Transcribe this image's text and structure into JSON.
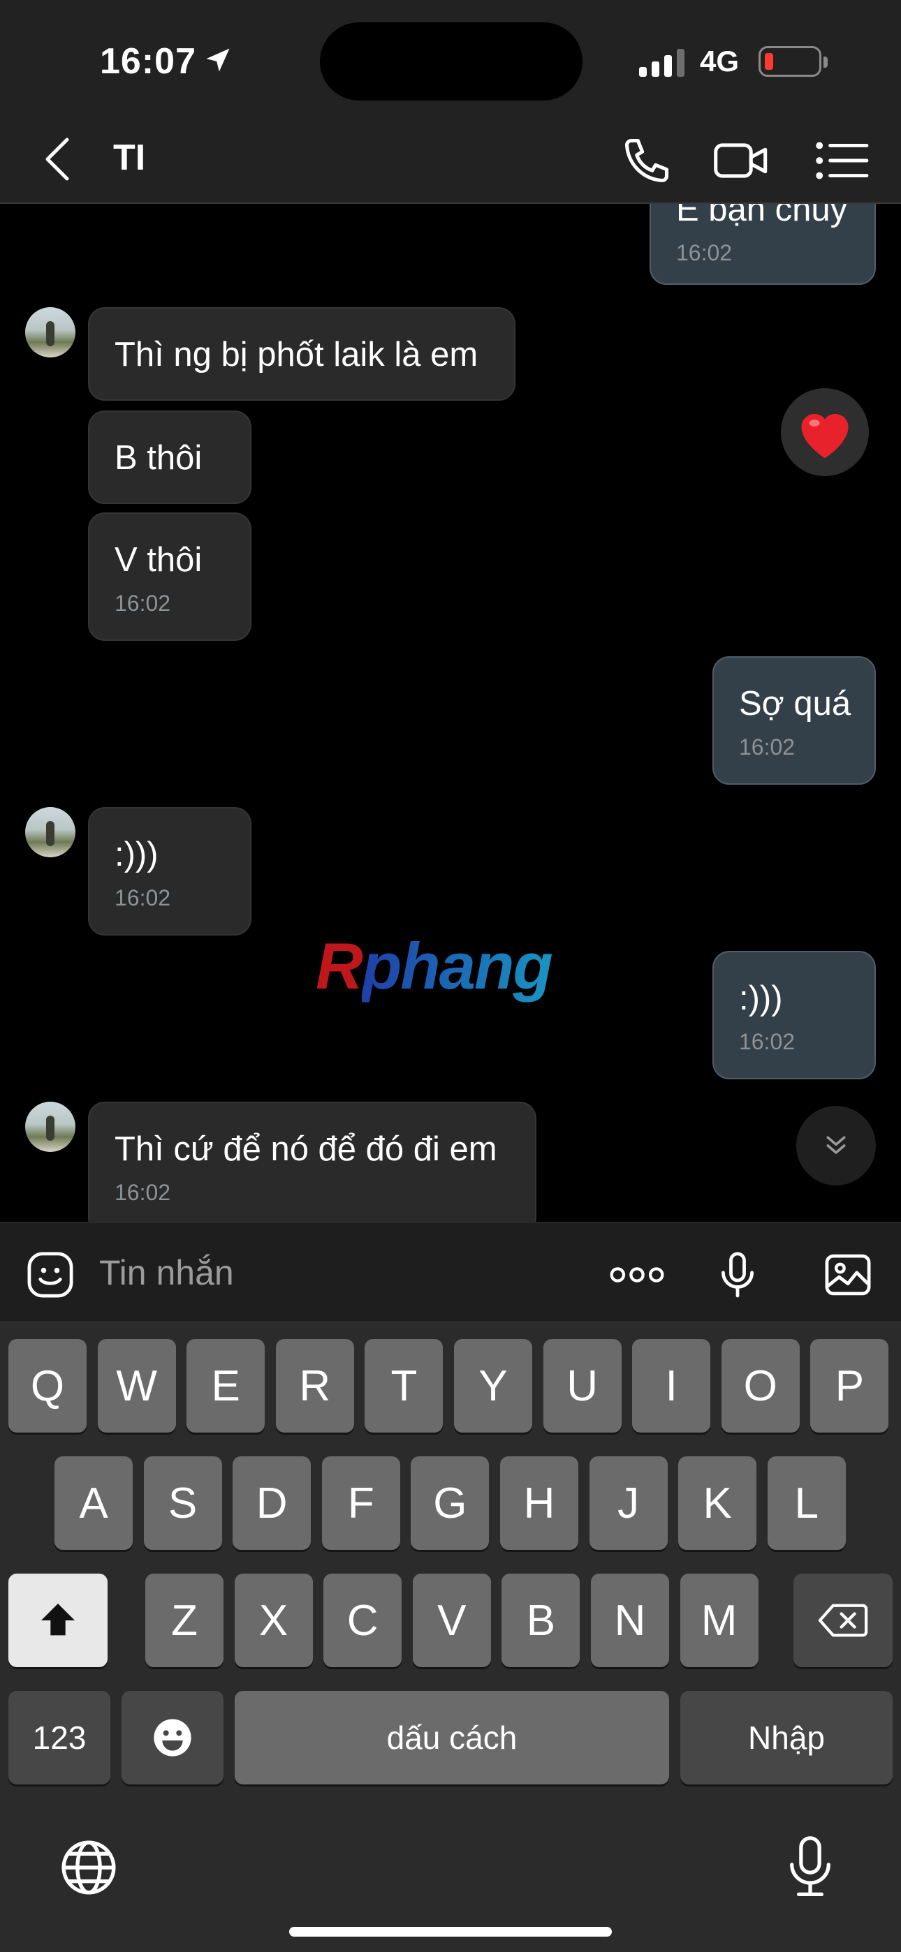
{
  "status_bar": {
    "time": "16:07",
    "network": "4G",
    "location_icon": "location-arrow-icon",
    "signal_icon": "signal-bars-icon",
    "battery_icon": "battery-low-icon",
    "battery_level": 0.1,
    "battery_color": "#ff3b30"
  },
  "header": {
    "title": "TI",
    "icons": [
      "back-chevron-icon",
      "phone-icon",
      "video-camera-icon",
      "menu-list-icon"
    ]
  },
  "chat": {
    "messages": [
      {
        "direction": "out",
        "text": "E bạn chủy",
        "time": "16:02"
      },
      {
        "direction": "in",
        "text": "Thì ng bị phốt laik là em"
      },
      {
        "direction": "in",
        "text": "B thôi"
      },
      {
        "direction": "in",
        "text": "V thôi",
        "time": "16:02"
      },
      {
        "direction": "out",
        "text": "Sợ quá",
        "time": "16:02"
      },
      {
        "direction": "in",
        "text": ":)))",
        "time": "16:02"
      },
      {
        "direction": "out",
        "text": ":)))",
        "time": "16:02"
      },
      {
        "direction": "in",
        "text": "Thì cứ để nó để đó đi em",
        "time": "16:02"
      }
    ],
    "reaction": "❤",
    "reaction_icon": "heart-reaction-icon",
    "scroll_icon": "double-chevron-down-icon",
    "watermark": {
      "part1": "R",
      "part2": "phang"
    }
  },
  "composer": {
    "placeholder": "Tin nhắn",
    "icons": [
      "sticker-smile-icon",
      "more-dots-icon",
      "microphone-icon",
      "image-icon"
    ]
  },
  "keyboard": {
    "row1": [
      "Q",
      "W",
      "E",
      "R",
      "T",
      "Y",
      "U",
      "I",
      "O",
      "P"
    ],
    "row2": [
      "A",
      "S",
      "D",
      "F",
      "G",
      "H",
      "J",
      "K",
      "L"
    ],
    "row3": [
      "Z",
      "X",
      "C",
      "V",
      "B",
      "N",
      "M"
    ],
    "numbers_label": "123",
    "space_label": "dấu cách",
    "return_label": "Nhập",
    "icons": [
      "shift-arrow-icon",
      "backspace-icon",
      "emoji-icon",
      "globe-icon",
      "dictation-mic-icon"
    ]
  }
}
